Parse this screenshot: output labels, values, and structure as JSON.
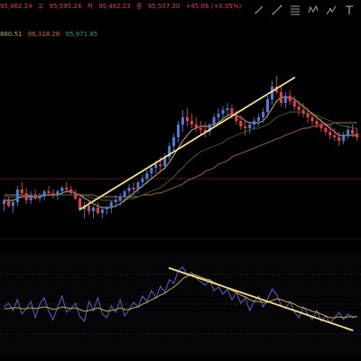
{
  "colors": {
    "up": "#4a7bd8",
    "down": "#e0404c",
    "trendline": "#f5e27a",
    "ma_fast": "#d8c27a",
    "ma_mid": "#2f6e36",
    "ma_slow": "#b86a3a",
    "oscillator": "#5b5fc7",
    "signal": "#c8a93a",
    "level": "#e0404c",
    "legend_ohlc": "#e0404c",
    "legend_ma1": "#b6a867",
    "legend_ma2": "#d36b3a",
    "legend_ma3": "#2fa36b"
  },
  "legend": {
    "open": "95,462.24",
    "high_label": "고",
    "high": "95,595.24",
    "low_label": "저",
    "low": "95,462.23",
    "close_label": "종",
    "close": "95,507.30",
    "change": "+45.06 (+0.05%)",
    "ma1": "860.51",
    "ma2": "96,318.26",
    "ma3": "95,971.85"
  },
  "toolbar": {
    "icons": [
      "brush-icon",
      "line-tool-icon",
      "fib-icon",
      "pattern-icon",
      "projection-icon",
      "text-icon"
    ]
  },
  "chart_data": {
    "type": "candlestick",
    "candles_ohlc": [
      [
        42,
        45,
        38,
        44
      ],
      [
        44,
        46,
        40,
        41
      ],
      [
        41,
        44,
        37,
        43
      ],
      [
        43,
        52,
        41,
        50
      ],
      [
        50,
        54,
        47,
        48
      ],
      [
        48,
        51,
        42,
        44
      ],
      [
        44,
        49,
        42,
        47
      ],
      [
        47,
        50,
        44,
        45
      ],
      [
        45,
        48,
        43,
        46
      ],
      [
        46,
        50,
        44,
        49
      ],
      [
        49,
        52,
        47,
        48
      ],
      [
        48,
        50,
        45,
        47
      ],
      [
        47,
        50,
        44,
        49
      ],
      [
        49,
        52,
        47,
        51
      ],
      [
        51,
        54,
        48,
        50
      ],
      [
        50,
        52,
        47,
        48
      ],
      [
        48,
        50,
        44,
        45
      ],
      [
        45,
        47,
        38,
        39
      ],
      [
        39,
        43,
        34,
        41
      ],
      [
        41,
        44,
        36,
        38
      ],
      [
        38,
        41,
        34,
        40
      ],
      [
        40,
        43,
        36,
        37
      ],
      [
        37,
        40,
        34,
        39
      ],
      [
        39,
        41,
        36,
        40
      ],
      [
        40,
        44,
        37,
        43
      ],
      [
        43,
        47,
        40,
        44
      ],
      [
        44,
        48,
        41,
        46
      ],
      [
        46,
        50,
        43,
        49
      ],
      [
        49,
        53,
        46,
        51
      ],
      [
        51,
        54,
        47,
        50
      ],
      [
        50,
        55,
        48,
        54
      ],
      [
        54,
        58,
        51,
        56
      ],
      [
        56,
        61,
        53,
        59
      ],
      [
        59,
        64,
        56,
        62
      ],
      [
        62,
        66,
        59,
        64
      ],
      [
        64,
        68,
        60,
        63
      ],
      [
        63,
        70,
        61,
        68
      ],
      [
        68,
        76,
        66,
        74
      ],
      [
        74,
        81,
        71,
        79
      ],
      [
        79,
        88,
        76,
        86
      ],
      [
        86,
        94,
        82,
        90
      ],
      [
        90,
        95,
        85,
        88
      ],
      [
        88,
        92,
        84,
        86
      ],
      [
        86,
        90,
        82,
        84
      ],
      [
        84,
        88,
        80,
        83
      ],
      [
        83,
        87,
        79,
        82
      ],
      [
        82,
        87,
        80,
        86
      ],
      [
        86,
        92,
        84,
        90
      ],
      [
        90,
        95,
        87,
        92
      ],
      [
        92,
        96,
        89,
        94
      ],
      [
        94,
        98,
        91,
        95
      ],
      [
        95,
        97,
        89,
        91
      ],
      [
        91,
        94,
        86,
        88
      ],
      [
        88,
        91,
        83,
        85
      ],
      [
        85,
        88,
        80,
        84
      ],
      [
        84,
        87,
        81,
        86
      ],
      [
        86,
        90,
        83,
        88
      ],
      [
        88,
        92,
        85,
        90
      ],
      [
        90,
        95,
        87,
        93
      ],
      [
        93,
        102,
        90,
        100
      ],
      [
        100,
        110,
        97,
        107
      ],
      [
        107,
        113,
        103,
        104
      ],
      [
        104,
        108,
        96,
        98
      ],
      [
        98,
        104,
        95,
        102
      ],
      [
        102,
        105,
        97,
        99
      ],
      [
        99,
        102,
        94,
        96
      ],
      [
        96,
        99,
        91,
        94
      ],
      [
        94,
        98,
        90,
        92
      ],
      [
        92,
        95,
        87,
        90
      ],
      [
        90,
        93,
        86,
        88
      ],
      [
        88,
        91,
        84,
        86
      ],
      [
        86,
        89,
        82,
        84
      ],
      [
        84,
        87,
        80,
        82
      ],
      [
        82,
        86,
        78,
        80
      ],
      [
        80,
        84,
        77,
        79
      ],
      [
        79,
        82,
        74,
        77
      ],
      [
        77,
        82,
        75,
        80
      ],
      [
        80,
        85,
        78,
        83
      ],
      [
        83,
        86,
        79,
        81
      ],
      [
        81,
        84,
        77,
        79
      ]
    ],
    "ma_fast": [
      44,
      44,
      44,
      45,
      46,
      46,
      46,
      46,
      46,
      47,
      47,
      47,
      47,
      48,
      49,
      49,
      48,
      47,
      45,
      44,
      42,
      41,
      40,
      40,
      40,
      41,
      42,
      44,
      46,
      48,
      50,
      52,
      54,
      56,
      58,
      60,
      62,
      65,
      69,
      73,
      77,
      80,
      83,
      84,
      85,
      85,
      85,
      86,
      87,
      89,
      91,
      92,
      91,
      90,
      88,
      87,
      87,
      87,
      88,
      91,
      95,
      99,
      101,
      101,
      101,
      100,
      98,
      96,
      94,
      92,
      90,
      88,
      86,
      84,
      82,
      80,
      80,
      80,
      80,
      80
    ],
    "ma_mid": [
      46,
      46,
      46,
      46,
      46,
      46,
      47,
      47,
      47,
      47,
      47,
      47,
      47,
      47,
      47,
      47,
      47,
      47,
      46,
      46,
      45,
      45,
      44,
      44,
      44,
      44,
      44,
      44,
      45,
      45,
      46,
      47,
      48,
      49,
      50,
      51,
      53,
      55,
      57,
      60,
      62,
      65,
      67,
      69,
      71,
      72,
      73,
      74,
      75,
      76,
      78,
      79,
      80,
      81,
      82,
      83,
      84,
      84,
      85,
      86,
      88,
      90,
      91,
      92,
      93,
      93,
      93,
      93,
      92,
      92,
      91,
      90,
      89,
      88,
      87,
      86,
      85,
      85,
      84,
      84
    ],
    "ma_slow": [
      47,
      47,
      47,
      47,
      47,
      47,
      47,
      47,
      47,
      47,
      47,
      47,
      47,
      47,
      47,
      47,
      47,
      47,
      47,
      47,
      47,
      46,
      46,
      46,
      46,
      46,
      46,
      46,
      46,
      46,
      46,
      47,
      47,
      47,
      48,
      48,
      49,
      50,
      51,
      52,
      53,
      55,
      56,
      57,
      58,
      60,
      61,
      62,
      64,
      65,
      66,
      68,
      69,
      70,
      71,
      72,
      73,
      74,
      75,
      76,
      77,
      78,
      79,
      80,
      81,
      82,
      83,
      84,
      84,
      85,
      85,
      86,
      86,
      86,
      87,
      87,
      87,
      87,
      87,
      87
    ],
    "trendlines": [
      {
        "from": [
          17,
          39
        ],
        "to": [
          65,
          112
        ]
      },
      {
        "osc_from": [
          37,
          95
        ],
        "osc_to": [
          78,
          26
        ]
      }
    ],
    "horizontal_level": 56,
    "oscillator": [
      52,
      56,
      48,
      60,
      44,
      50,
      58,
      40,
      55,
      62,
      47,
      38,
      52,
      64,
      46,
      50,
      56,
      41,
      36,
      58,
      48,
      62,
      44,
      40,
      53,
      46,
      60,
      42,
      49,
      57,
      52,
      64,
      58,
      70,
      62,
      75,
      68,
      82,
      78,
      92,
      96,
      88,
      90,
      84,
      80,
      76,
      82,
      70,
      74,
      66,
      72,
      60,
      68,
      56,
      62,
      48,
      58,
      64,
      52,
      60,
      72,
      66,
      54,
      50,
      58,
      46,
      40,
      52,
      44,
      38,
      48,
      36,
      42,
      34,
      40,
      46,
      38,
      44,
      40,
      42
    ],
    "signal": [
      50,
      50,
      51,
      51,
      50,
      50,
      51,
      50,
      51,
      52,
      51,
      49,
      50,
      52,
      51,
      50,
      51,
      49,
      47,
      48,
      49,
      51,
      49,
      47,
      48,
      49,
      51,
      49,
      49,
      51,
      52,
      55,
      57,
      60,
      62,
      65,
      67,
      71,
      74,
      78,
      83,
      86,
      88,
      87,
      85,
      83,
      82,
      79,
      77,
      75,
      73,
      70,
      68,
      65,
      63,
      60,
      58,
      58,
      57,
      57,
      59,
      61,
      60,
      58,
      57,
      55,
      52,
      51,
      49,
      47,
      46,
      44,
      42,
      40,
      40,
      41,
      40,
      41,
      41,
      41
    ],
    "osc_ylim": [
      0,
      110
    ],
    "price_ylim": [
      20,
      120
    ]
  }
}
